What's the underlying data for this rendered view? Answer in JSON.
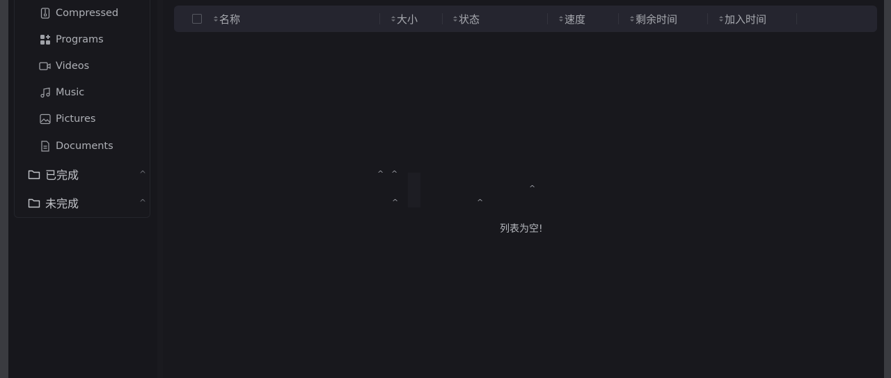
{
  "sidebar": {
    "categories": [
      {
        "label": "Compressed",
        "icon": "archive-icon"
      },
      {
        "label": "Programs",
        "icon": "apps-icon"
      },
      {
        "label": "Videos",
        "icon": "video-icon"
      },
      {
        "label": "Music",
        "icon": "music-icon"
      },
      {
        "label": "Pictures",
        "icon": "image-icon"
      },
      {
        "label": "Documents",
        "icon": "document-icon"
      }
    ],
    "folders": [
      {
        "label": "已完成",
        "icon": "folder-icon",
        "chevron": "^"
      },
      {
        "label": "未完成",
        "icon": "folder-icon",
        "chevron": "^"
      }
    ]
  },
  "table": {
    "columns": [
      "名称",
      "大小",
      "状态",
      "速度",
      "剩余时间",
      "加入时间"
    ],
    "empty_message": "列表为空!"
  },
  "carets": {
    "symbol": "^"
  },
  "colors": {
    "background": "#17171c",
    "header": "#25252f",
    "text": "#aeb0b6"
  }
}
